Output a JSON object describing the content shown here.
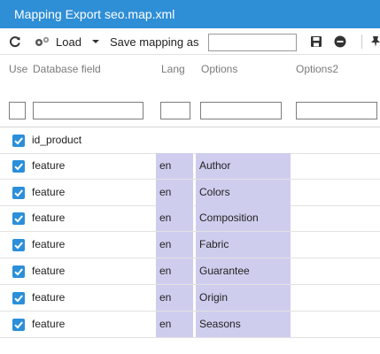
{
  "window": {
    "title": "Mapping Export seo.map.xml"
  },
  "toolbar": {
    "load_label": "Load",
    "save_mapping_label": "Save mapping as",
    "save_mapping_value": "",
    "icons": [
      "refresh-icon",
      "load-icon",
      "chevron-down-icon",
      "save-icon",
      "minus-circle-icon",
      "pin-icon"
    ]
  },
  "table": {
    "columns": [
      "Use",
      "Database field",
      "Lang",
      "Options",
      "Options2"
    ],
    "filters": {
      "use": "",
      "field": "",
      "lang": "",
      "options": "",
      "options2": ""
    },
    "rows": [
      {
        "use": true,
        "field": "id_product",
        "lang": "",
        "option": ""
      },
      {
        "use": true,
        "field": "feature",
        "lang": "en",
        "option": "Author"
      },
      {
        "use": true,
        "field": "feature",
        "lang": "en",
        "option": "Colors"
      },
      {
        "use": true,
        "field": "feature",
        "lang": "en",
        "option": "Composition"
      },
      {
        "use": true,
        "field": "feature",
        "lang": "en",
        "option": "Fabric"
      },
      {
        "use": true,
        "field": "feature",
        "lang": "en",
        "option": "Guarantee"
      },
      {
        "use": true,
        "field": "feature",
        "lang": "en",
        "option": "Origin"
      },
      {
        "use": true,
        "field": "feature",
        "lang": "en",
        "option": "Seasons"
      }
    ]
  },
  "colors": {
    "title_bar": "#2e8ed6",
    "checkbox": "#2b8fd9",
    "lang_option_highlight": "#cfcdee"
  }
}
